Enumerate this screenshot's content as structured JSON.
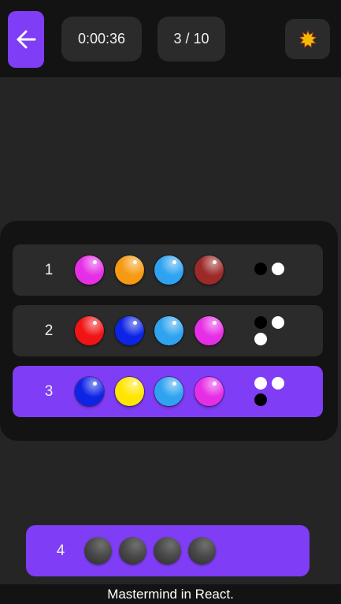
{
  "header": {
    "back_icon": "arrow-left-icon",
    "timer": "0:00:36",
    "turn_counter": "3 / 10",
    "theme_icon": "sun-icon"
  },
  "colors": {
    "accent": "#7f3df5",
    "magenta": "#e62ee6",
    "orange": "#f59a12",
    "lightblue": "#2fa3f0",
    "darkred": "#9c2a28",
    "red": "#f01414",
    "blue": "#0d24e6",
    "yellow": "#ffe600"
  },
  "guesses": [
    {
      "number": "1",
      "pegs": [
        "magenta",
        "orange",
        "lightblue",
        "darkred"
      ],
      "feedback": [
        "black",
        "white"
      ]
    },
    {
      "number": "2",
      "pegs": [
        "red",
        "blue",
        "lightblue",
        "magenta"
      ],
      "feedback": [
        "black",
        "white",
        "white"
      ]
    },
    {
      "number": "3",
      "pegs": [
        "blue",
        "yellow",
        "lightblue",
        "magenta"
      ],
      "feedback": [
        "white",
        "white",
        "black"
      ],
      "active": true
    }
  ],
  "current_row": {
    "number": "4",
    "slots": 4
  },
  "footer": {
    "text": "Mastermind in React."
  }
}
